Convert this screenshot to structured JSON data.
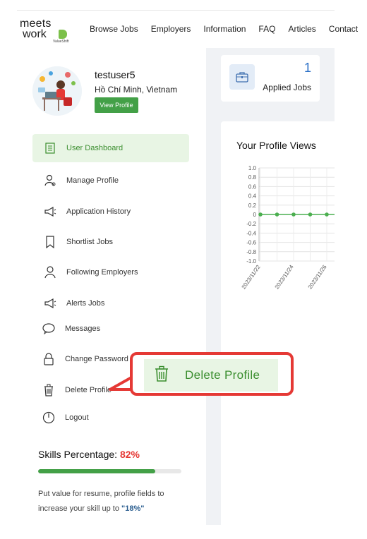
{
  "brand": {
    "line1": "meets",
    "line2": "work",
    "tagline": "ValueShift"
  },
  "nav": [
    "Browse Jobs",
    "Employers",
    "Information",
    "FAQ",
    "Articles",
    "Contact"
  ],
  "profile": {
    "username": "testuser5",
    "location": "Hồ Chí Minh, Vietnam",
    "view_button": "View Profile"
  },
  "menu": [
    {
      "label": "User Dashboard",
      "icon": "document-icon",
      "active": true
    },
    {
      "label": "Manage Profile",
      "icon": "user-gear-icon"
    },
    {
      "label": "Application History",
      "icon": "megaphone-icon"
    },
    {
      "label": "Shortlist Jobs",
      "icon": "bookmark-icon"
    },
    {
      "label": "Following Employers",
      "icon": "person-icon"
    },
    {
      "label": "Alerts Jobs",
      "icon": "megaphone-icon"
    },
    {
      "label": "Messages",
      "icon": "chat-icon"
    },
    {
      "label": "Change Password",
      "icon": "lock-icon"
    },
    {
      "label": "Delete Profile",
      "icon": "trash-icon"
    },
    {
      "label": "Logout",
      "icon": "power-icon"
    }
  ],
  "skills": {
    "title": "Skills Percentage:",
    "percent_text": "82%",
    "percent": 82,
    "note_prefix": "Put value for resume, profile fields to increase your skill up to ",
    "note_value": "\"18%\""
  },
  "applied": {
    "count": "1",
    "label": "Applied Jobs"
  },
  "views": {
    "title": "Your Profile Views"
  },
  "callout": {
    "label": "Delete Profile"
  },
  "colors": {
    "accent_green": "#43a047",
    "active_bg": "#e8f5e4",
    "highlight_red": "#e53935",
    "link_blue": "#2a6fc7"
  },
  "chart_data": {
    "type": "line",
    "x": [
      "2023/11/22",
      "2023/11/23",
      "2023/11/24",
      "2023/11/25",
      "2023/11/26"
    ],
    "x_tick_labels": [
      "2023/11/22",
      "2023/11/24",
      "2023/11/26"
    ],
    "series": [
      {
        "values": [
          0,
          0,
          0,
          0,
          0
        ]
      }
    ],
    "y_ticks": [
      "1.0",
      "0.8",
      "0.6",
      "0.4",
      "0.2",
      "0",
      "-0.2",
      "-0.4",
      "-0.6",
      "-0.8",
      "-1.0"
    ],
    "ylim": [
      -1,
      1
    ],
    "grid": true,
    "line_color": "#4caf50"
  }
}
